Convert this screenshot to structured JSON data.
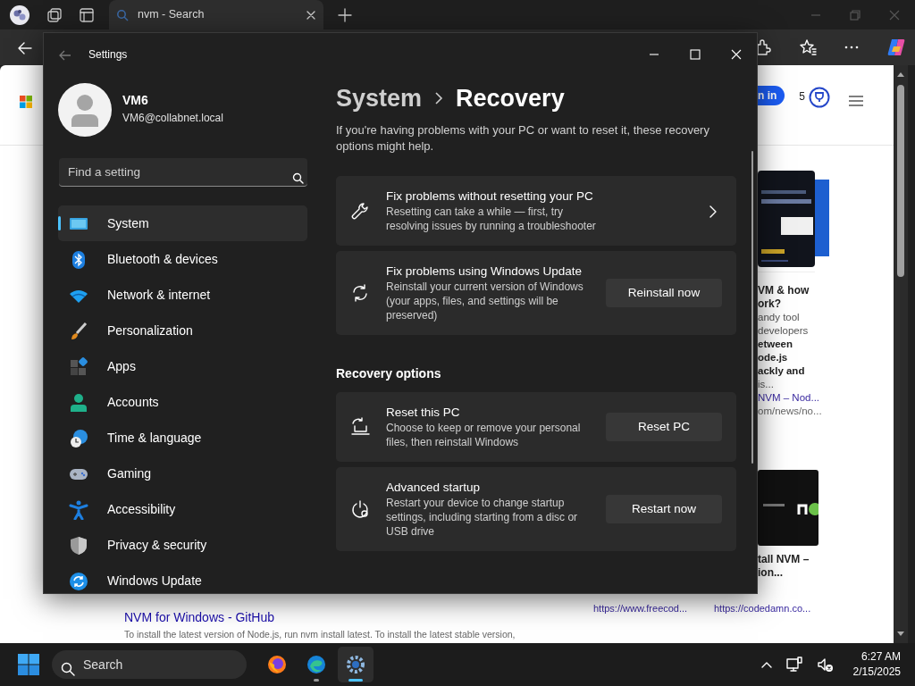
{
  "browser": {
    "tab": {
      "title": "nvm - Search",
      "selected": true
    },
    "page": {
      "signin": "n in",
      "rewards_count": "5",
      "top_card": [
        {
          "kind": "title",
          "text": "VM & how"
        },
        {
          "kind": "title",
          "text": "ork?"
        },
        {
          "kind": "snippet",
          "text": "andy tool"
        },
        {
          "kind": "snippet",
          "text": " developers"
        },
        {
          "kind": "bold",
          "text": "etween"
        },
        {
          "kind": "bold",
          "text": "ode.js"
        },
        {
          "kind": "bold",
          "text": "ackly and"
        },
        {
          "kind": "snippet",
          "text": " is..."
        },
        {
          "kind": "source",
          "text": "NVM – Nod..."
        },
        {
          "kind": "url",
          "text": "om/news/no..."
        }
      ],
      "bottom_card": [
        {
          "kind": "title",
          "text": "tall NVM –"
        },
        {
          "kind": "title",
          "text": "ion..."
        }
      ],
      "result": {
        "title": "NVM for Windows - GitHub",
        "snippet": "To install the latest version of Node.js, run nvm install latest. To install the latest stable version,"
      },
      "urls": [
        "https://www.freecod...",
        "https://codedamn.co..."
      ]
    }
  },
  "settings": {
    "title": "Settings",
    "user": {
      "name": "VM6",
      "email": "VM6@collabnet.local"
    },
    "search": {
      "placeholder": "Find a setting"
    },
    "nav": [
      {
        "label": "System",
        "selected": true
      },
      {
        "label": "Bluetooth & devices",
        "selected": false
      },
      {
        "label": "Network & internet",
        "selected": false
      },
      {
        "label": "Personalization",
        "selected": false
      },
      {
        "label": "Apps",
        "selected": false
      },
      {
        "label": "Accounts",
        "selected": false
      },
      {
        "label": "Time & language",
        "selected": false
      },
      {
        "label": "Gaming",
        "selected": false
      },
      {
        "label": "Accessibility",
        "selected": false
      },
      {
        "label": "Privacy & security",
        "selected": false
      },
      {
        "label": "Windows Update",
        "selected": false
      }
    ],
    "breadcrumb": [
      "System",
      "Recovery"
    ],
    "intro": "If you're having problems with your PC or want to reset it, these recovery options might help.",
    "cards": [
      {
        "kind": "link",
        "title": "Fix problems without resetting your PC",
        "description": "Resetting can take a while — first, try resolving issues by running a troubleshooter"
      },
      {
        "kind": "button",
        "title": "Fix problems using Windows Update",
        "description": "Reinstall your current version of Windows (your apps, files, and settings will be preserved)",
        "button": "Reinstall now"
      }
    ],
    "section": "Recovery options",
    "options": [
      {
        "kind": "button",
        "title": "Reset this PC",
        "description": "Choose to keep or remove your personal files, then reinstall Windows",
        "button": "Reset PC"
      },
      {
        "kind": "button",
        "title": "Advanced startup",
        "description": "Restart your device to change startup settings, including starting from a disc or USB drive",
        "button": "Restart now"
      }
    ]
  },
  "taskbar": {
    "search": {
      "placeholder": "Search"
    },
    "apps": [
      {
        "selected": false,
        "running": false
      },
      {
        "selected": false,
        "running": true
      },
      {
        "selected": true,
        "running": true
      }
    ],
    "time": "6:27 AM",
    "date": "2/15/2025"
  }
}
